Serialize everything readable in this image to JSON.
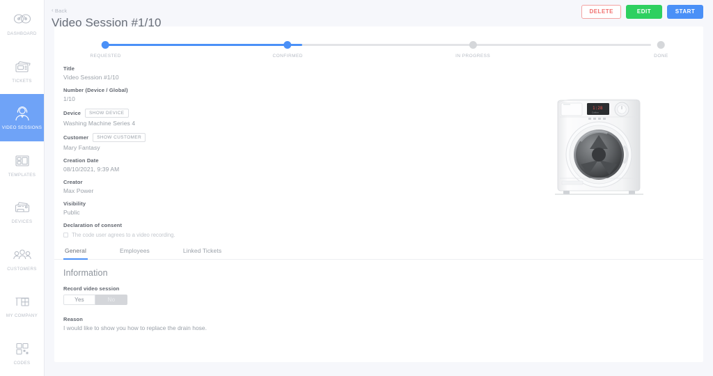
{
  "sidebar": {
    "items": [
      {
        "label": "DASHBOARD",
        "icon": "dashboard-gauge-icon",
        "active": false
      },
      {
        "label": "TICKETS",
        "icon": "tickets-icon",
        "active": false
      },
      {
        "label": "VIDEO SESSIONS",
        "icon": "video-support-agent-icon",
        "active": true
      },
      {
        "label": "TEMPLATES",
        "icon": "templates-grid-icon",
        "active": false
      },
      {
        "label": "DEVICES",
        "icon": "devices-printer-icon",
        "active": false
      },
      {
        "label": "CUSTOMERS",
        "icon": "customers-people-icon",
        "active": false
      },
      {
        "label": "MY COMPANY",
        "icon": "company-desk-icon",
        "active": false
      },
      {
        "label": "CODES",
        "icon": "codes-qr-icon",
        "active": false
      }
    ]
  },
  "header": {
    "back_label": "Back",
    "back_icon": "chevron-left-icon",
    "title": "Video Session #1/10",
    "actions": [
      {
        "label": "DELETE",
        "style": "delete",
        "color": "#f0706f"
      },
      {
        "label": "EDIT",
        "style": "edit",
        "color": "#2ed060"
      },
      {
        "label": "START",
        "style": "start",
        "color": "#4a90f7"
      }
    ]
  },
  "stepper": {
    "active_color": "#4a90f7",
    "inactive_color": "#d5d7da",
    "steps": [
      {
        "label": "REQUESTED",
        "done": true,
        "pos": 5
      },
      {
        "label": "CONFIRMED",
        "done": true,
        "pos": 35
      },
      {
        "label": "IN PROGRESS",
        "done": false,
        "pos": 65.5
      },
      {
        "label": "DONE",
        "done": false,
        "pos": 96.5
      }
    ]
  },
  "details": {
    "title": {
      "label": "Title",
      "value": "Video Session #1/10"
    },
    "number": {
      "label": "Number (Device / Global)",
      "value": "1/10"
    },
    "device": {
      "label": "Device",
      "chip": "SHOW DEVICE",
      "value": "Washing Machine Series 4"
    },
    "customer": {
      "label": "Customer",
      "chip": "SHOW CUSTOMER",
      "value": "Mary Fantasy"
    },
    "creation_date": {
      "label": "Creation Date",
      "value": "08/10/2021, 9:39 AM"
    },
    "creator": {
      "label": "Creator",
      "value": "Max Power"
    },
    "visibility": {
      "label": "Visibility",
      "value": "Public"
    },
    "consent": {
      "label": "Declaration of consent",
      "checkbox_checked": false,
      "text": "The code user agrees to a video recording."
    }
  },
  "device_photo": {
    "alt": "washing-machine-photo"
  },
  "tabs": [
    {
      "label": "General",
      "active": true
    },
    {
      "label": "Employees",
      "active": false
    },
    {
      "label": "Linked Tickets",
      "active": false
    }
  ],
  "general": {
    "section_title": "Information",
    "record_label": "Record video session",
    "toggle_yes": "Yes",
    "toggle_no": "No",
    "toggle_selected": "Yes",
    "reason_label": "Reason",
    "reason_text": "I would like to show you how to replace the drain hose."
  }
}
